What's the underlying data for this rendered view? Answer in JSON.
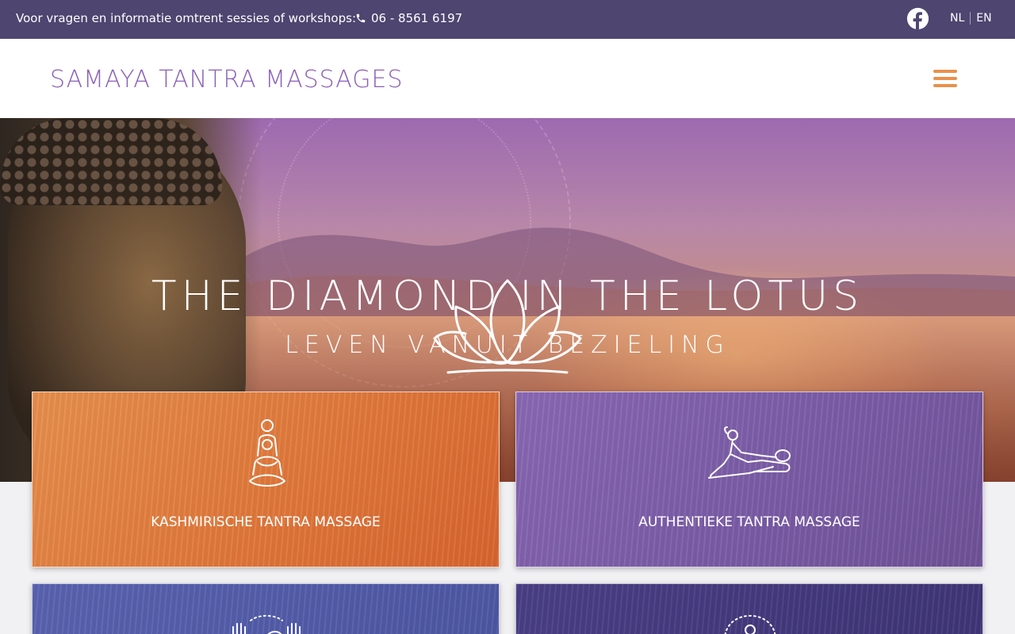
{
  "topbar": {
    "info": "Voor vragen en informatie omtrent sessies of workshops:",
    "phone": "06 - 8561 6197",
    "phone_icon": "phone-icon",
    "social_icon": "facebook-icon",
    "lang_nl": "NL",
    "lang_en": "EN"
  },
  "header": {
    "brand": "SAMAYA TANTRA MASSAGES",
    "menu_icon": "hamburger-menu-icon"
  },
  "hero": {
    "emblem_icon": "lotus-icon",
    "title": "THE DIAMOND IN THE LOTUS",
    "subtitle": "LEVEN VANUIT BEZIELING"
  },
  "cards": [
    {
      "label": "KASHMIRISCHE TANTRA MASSAGE",
      "icon": "meditation-couple-icon"
    },
    {
      "label": "AUTHENTIEKE TANTRA MASSAGE",
      "icon": "massage-icon"
    },
    {
      "label": "",
      "icon": "hands-icon"
    },
    {
      "label": "",
      "icon": "figure-aura-icon"
    }
  ],
  "colors": {
    "topbar": "#4e4570",
    "brand": "#8a5fb8",
    "menu": "#e9914a",
    "card_orange": "#e27a3c",
    "card_purple": "#7c5da8",
    "card_blue": "#4d57a3",
    "card_indigo": "#3f3577"
  }
}
